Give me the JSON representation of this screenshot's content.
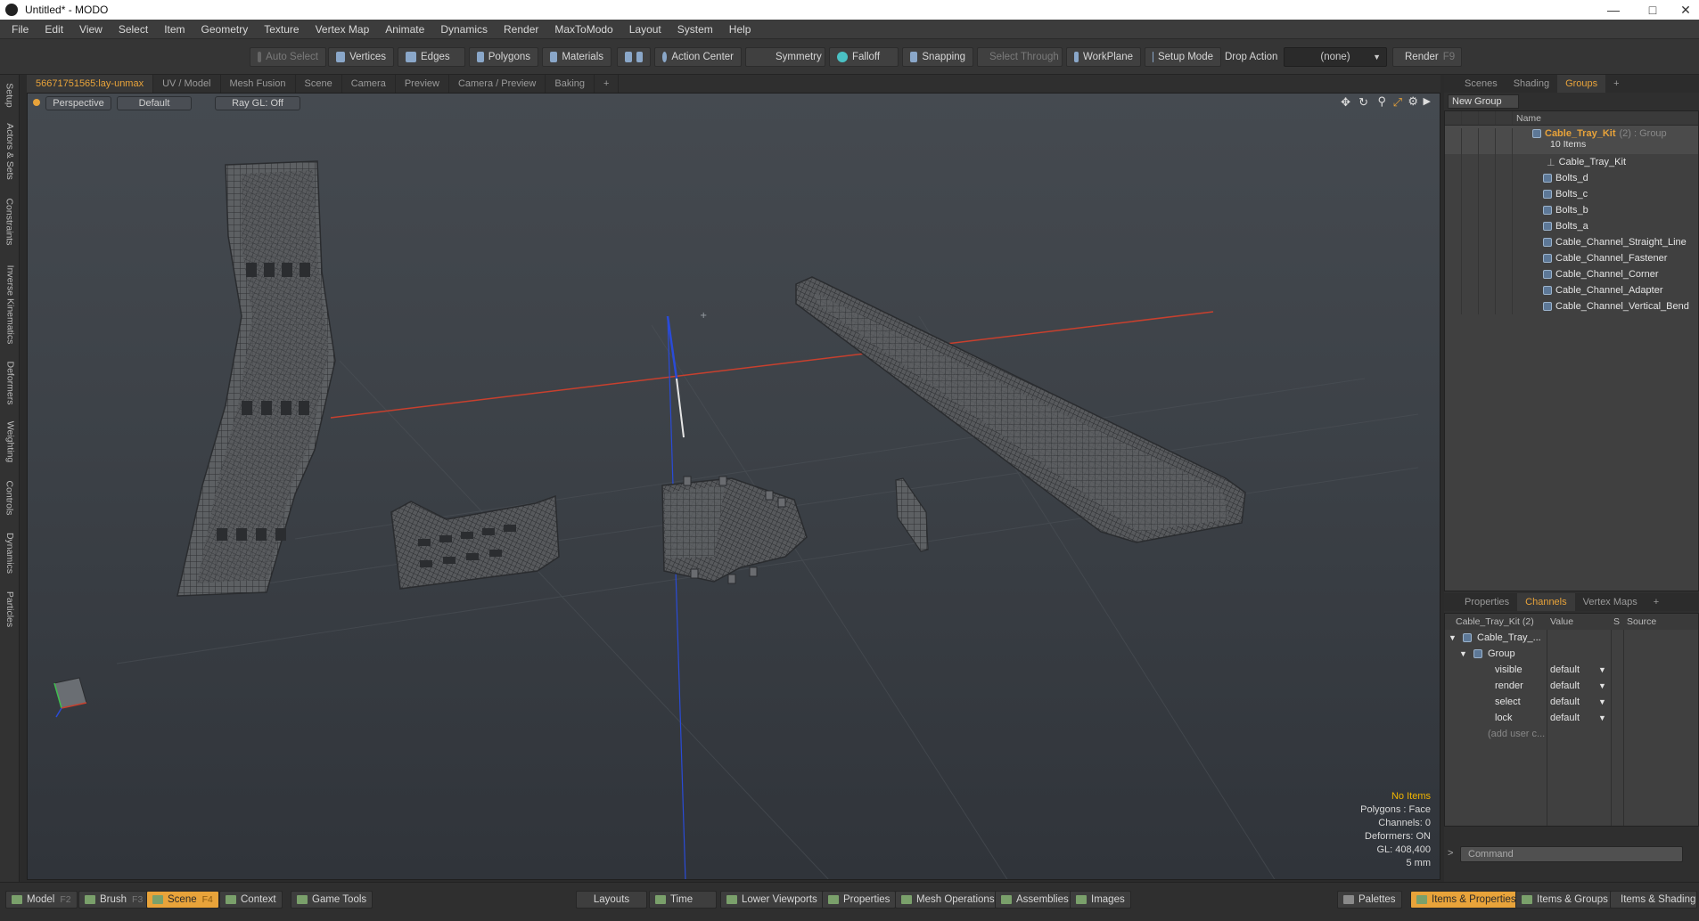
{
  "window": {
    "title": "Untitled* - MODO"
  },
  "menu": [
    "File",
    "Edit",
    "View",
    "Select",
    "Item",
    "Geometry",
    "Texture",
    "Vertex Map",
    "Animate",
    "Dynamics",
    "Render",
    "MaxToModo",
    "Layout",
    "System",
    "Help"
  ],
  "toolbar": {
    "auto_select": "Auto Select",
    "vertices": "Vertices",
    "edges": "Edges",
    "polygons": "Polygons",
    "materials": "Materials",
    "action_center": "Action Center",
    "symmetry": "Symmetry",
    "falloff": "Falloff",
    "snapping": "Snapping",
    "select_through": "Select Through",
    "workplane": "WorkPlane",
    "setup_mode": "Setup Mode",
    "drop_action": "Drop Action",
    "drop_value": "(none)",
    "render": "Render",
    "render_key": "F9"
  },
  "left_tabs": [
    "Setup",
    "Actors & Sets",
    "Constraints",
    "Inverse Kinematics",
    "Deformers",
    "Weighting",
    "Controls",
    "Dynamics",
    "Particles"
  ],
  "viewport_tabs": [
    "56671751565:lay-unmax",
    "UV / Model",
    "Mesh Fusion",
    "Scene",
    "Camera",
    "Preview",
    "Camera / Preview",
    "Baking",
    "+"
  ],
  "viewport": {
    "view": "Perspective",
    "shading": "Default",
    "raygl": "Ray GL: Off",
    "info": {
      "items": "No Items",
      "polygons": "Polygons : Face",
      "channels": "Channels: 0",
      "deformers": "Deformers: ON",
      "gl": "GL: 408,400",
      "unit": "5 mm"
    }
  },
  "groups_panel": {
    "tabs": [
      "Scenes",
      "Shading",
      "Groups",
      "+"
    ],
    "active_tab": "Groups",
    "new_group": "New Group",
    "name_header": "Name",
    "group_name": "Cable_Tray_Kit",
    "group_suffix": "(2) : Group",
    "group_count": "10 Items",
    "items": [
      "Cable_Tray_Kit",
      "Bolts_d",
      "Bolts_c",
      "Bolts_b",
      "Bolts_a",
      "Cable_Channel_Straight_Line",
      "Cable_Channel_Fastener",
      "Cable_Channel_Corner",
      "Cable_Channel_Adapter",
      "Cable_Channel_Vertical_Bend"
    ]
  },
  "channels_panel": {
    "tabs": [
      "Properties",
      "Channels",
      "Vertex Maps",
      "+"
    ],
    "active_tab": "Channels",
    "col_name": "Cable_Tray_Kit (2)",
    "col_value": "Value",
    "col_s": "S",
    "col_source": "Source",
    "root": "Cable_Tray_...",
    "group": "Group",
    "channels": [
      {
        "name": "visible",
        "value": "default"
      },
      {
        "name": "render",
        "value": "default"
      },
      {
        "name": "select",
        "value": "default"
      },
      {
        "name": "lock",
        "value": "default"
      }
    ],
    "add_user": "(add user c..."
  },
  "command": {
    "placeholder": "Command"
  },
  "bottom_bar": {
    "model": "Model",
    "model_key": "F2",
    "brush": "Brush",
    "brush_key": "F3",
    "scene": "Scene",
    "scene_key": "F4",
    "context": "Context",
    "game_tools": "Game Tools",
    "layouts": "Layouts",
    "time": "Time",
    "lower_viewports": "Lower Viewports",
    "properties": "Properties",
    "mesh_operations": "Mesh Operations",
    "assemblies": "Assemblies",
    "images": "Images",
    "palettes": "Palettes",
    "items_properties": "Items & Properties",
    "items_groups": "Items & Groups",
    "items_shading": "Items & Shading"
  },
  "colors": {
    "accent": "#e8a33a",
    "info_highlight": "#f0b400",
    "x_axis": "#c8402e",
    "y_axis": "#2a4bd7"
  }
}
